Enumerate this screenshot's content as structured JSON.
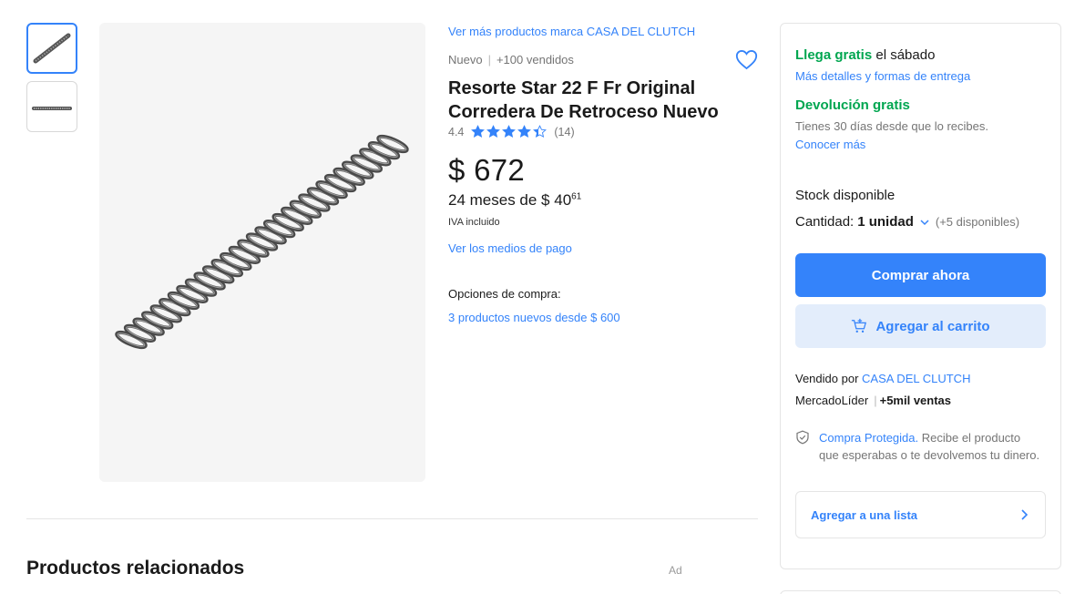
{
  "thumbnails": [
    {
      "alt": "spring-thumbnail-1",
      "active": true
    },
    {
      "alt": "spring-thumbnail-2",
      "active": false
    }
  ],
  "product": {
    "brand_link": "Ver más productos marca CASA DEL CLUTCH",
    "condition": "Nuevo",
    "sold": "+100 vendidos",
    "title": "Resorte Star 22 F Fr Original Corredera De Retroceso Nuevo",
    "rating_value": "4.4",
    "rating_count": "(14)",
    "stars": 4.4,
    "price": "$ 672",
    "installments_prefix": "24 meses de $ 40",
    "installments_cents": "61",
    "iva": "IVA incluido",
    "payment_link": "Ver los medios de pago",
    "options_label": "Opciones de compra:",
    "options_link": "3 productos nuevos desde $ 600"
  },
  "related": {
    "title": "Productos relacionados",
    "ad": "Ad"
  },
  "buybox": {
    "shipping_highlight": "Llega gratis",
    "shipping_rest": " el sábado",
    "shipping_link": "Más detalles y formas de entrega",
    "returns_title": "Devolución gratis",
    "returns_desc": "Tienes 30 días desde que lo recibes.",
    "returns_link": "Conocer más",
    "stock": "Stock disponible",
    "qty_label": "Cantidad:",
    "qty_value": "1 unidad",
    "qty_available": "(+5 disponibles)",
    "buy_now": "Comprar ahora",
    "add_cart": "Agregar al carrito",
    "seller_prefix": "Vendido por ",
    "seller_name": "CASA DEL CLUTCH",
    "leader": "MercadoLíder",
    "sales": "+5mil ventas",
    "protect_link": "Compra Protegida.",
    "protect_text": " Recibe el producto que esperabas o te devolvemos tu dinero.",
    "add_list": "Agregar a una lista"
  },
  "colors": {
    "accent": "#3483fa",
    "green": "#00a650",
    "secondary_bg": "#e3edfb"
  }
}
